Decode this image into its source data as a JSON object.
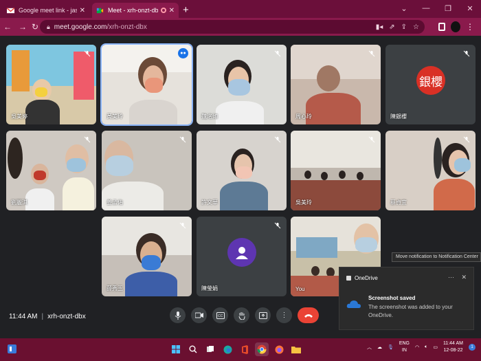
{
  "browser": {
    "tabs": [
      {
        "title": "Google meet link - jaspreet.k@t",
        "active": false
      },
      {
        "title": "Meet - xrh-onzt-dbx",
        "active": true
      }
    ],
    "url_host": "meet.google.com",
    "url_path": "/xrh-onzt-dbx",
    "new_tab_label": "+",
    "window_controls": {
      "chevron": "⌄",
      "minimize": "—",
      "restore": "❐",
      "close": "✕"
    }
  },
  "participants": [
    {
      "name": "吳美婷"
    },
    {
      "name": "黃美玲"
    },
    {
      "name": "魏洺如"
    },
    {
      "name": "周心玲"
    },
    {
      "name": "陳銀櫻",
      "avatar_text": "銀櫻",
      "avatar_color": "#d93025"
    },
    {
      "name": "劉麗淇"
    },
    {
      "name": "姜孟佑"
    },
    {
      "name": "許文華"
    },
    {
      "name": "吳美玲"
    },
    {
      "name": "蔡貞宜"
    },
    {
      "name": "薛秀玉"
    },
    {
      "name": "陳瑩娟",
      "avatar_color": "#5e35b1"
    },
    {
      "name": "You"
    }
  ],
  "meeting": {
    "time": "11:44 AM",
    "code": "xrh-onzt-dbx"
  },
  "notification_tooltip": "Move notification to Notification Center",
  "toast": {
    "app": "OneDrive",
    "title": "Screenshot saved",
    "body": "The screenshot was added to your OneDrive.",
    "more": "···",
    "close": "✕"
  },
  "tray": {
    "lang_top": "ENG",
    "lang_bottom": "IN",
    "time": "11:44 AM",
    "date": "12-08-22",
    "badge": "1"
  },
  "colors": {
    "accent": "#8ab4f8",
    "end_call": "#ea4335",
    "chrome_tab": "#6b0f3a",
    "taskbar": "#6a1030"
  }
}
